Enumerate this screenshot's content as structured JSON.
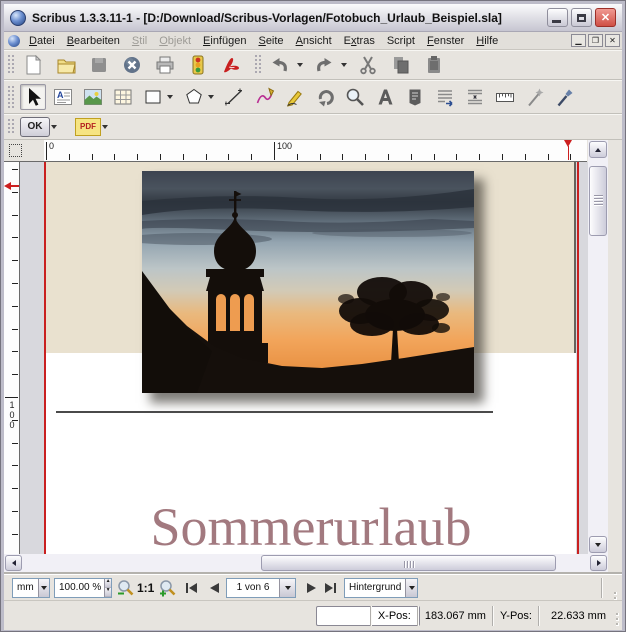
{
  "window": {
    "title": "Scribus 1.3.3.11-1 - [D:/Download/Scribus-Vorlagen/Fotobuch_Urlaub_Beispiel.sla]"
  },
  "menu": {
    "items": [
      {
        "label": "Datei",
        "u": 0,
        "disabled": false
      },
      {
        "label": "Bearbeiten",
        "u": 0,
        "disabled": false
      },
      {
        "label": "Stil",
        "u": 0,
        "disabled": true
      },
      {
        "label": "Objekt",
        "u": 0,
        "disabled": true
      },
      {
        "label": "Einfügen",
        "u": 0,
        "disabled": false
      },
      {
        "label": "Seite",
        "u": 0,
        "disabled": false
      },
      {
        "label": "Ansicht",
        "u": 0,
        "disabled": false
      },
      {
        "label": "Extras",
        "u": 1,
        "disabled": false
      },
      {
        "label": "Script",
        "u": -1,
        "disabled": false
      },
      {
        "label": "Fenster",
        "u": 0,
        "disabled": false
      },
      {
        "label": "Hilfe",
        "u": 0,
        "disabled": false
      }
    ]
  },
  "toolbar_file": {
    "buttons": [
      "new-document",
      "open-document",
      "save-document",
      "close-document",
      "print-document",
      "preflight-verifier",
      "export-pdf",
      "undo",
      "redo",
      "cut",
      "copy",
      "paste"
    ]
  },
  "toolbar_tools": {
    "buttons": [
      "select-item",
      "insert-text-frame",
      "insert-image-frame",
      "insert-table",
      "insert-shape",
      "insert-polygon",
      "insert-line",
      "insert-bezier-curve",
      "insert-freehand-line",
      "rotate-item",
      "zoom",
      "edit-contents-of-frame",
      "edit-text-story-editor",
      "link-text-frames",
      "unlink-text-frames",
      "measurements",
      "copy-item-properties",
      "eye-dropper"
    ]
  },
  "toolbar_pdf": {
    "ok_label": "OK",
    "pdf_label": "PDF"
  },
  "icons": {
    "scribus-logo": "blue sphere",
    "dropdown-arrow": "▾",
    "minimize": "▁",
    "maximize": "□",
    "close": "✕",
    "scroll-up": "▲",
    "scroll-down": "▼",
    "scroll-left": "◀",
    "scroll-right": "▶"
  },
  "rulers": {
    "h_zero": "0",
    "h_hundred": "100",
    "v_hundred": "100",
    "unit": "mm"
  },
  "page": {
    "heading": "Sommerurlaub",
    "heading_color": "#a2797f",
    "background_color": "#e9e1cf",
    "photo_alt": "church-tower-sunset-silhouette"
  },
  "statusbar": {
    "unit": "mm",
    "zoom_level": "100.00 %",
    "actual_size": "1:1",
    "page_indicator": "1 von 6",
    "layer": "Hintergrund"
  },
  "coords": {
    "x_label": "X-Pos:",
    "x_value": "183.067 mm",
    "y_label": "Y-Pos:",
    "y_value": "22.633 mm"
  }
}
